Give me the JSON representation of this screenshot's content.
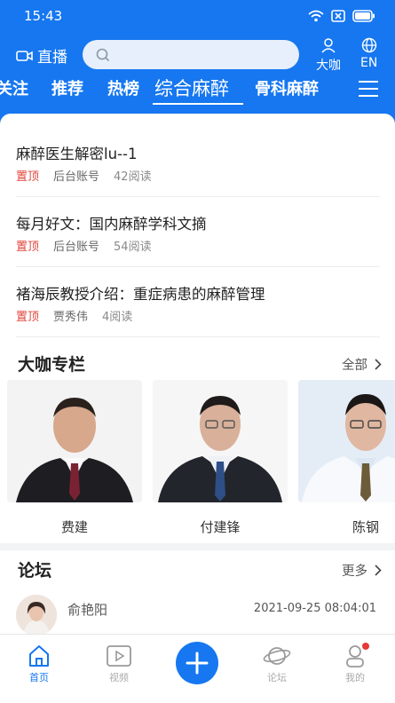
{
  "status_bar": {
    "time": "15:43"
  },
  "header": {
    "live_label": "直播",
    "search_placeholder": "",
    "expert_label": "大咖",
    "lang_label": "EN"
  },
  "tabs": [
    {
      "label": "关注",
      "active": false
    },
    {
      "label": "推荐",
      "active": false
    },
    {
      "label": "热榜",
      "active": false
    },
    {
      "label": "综合麻醉",
      "active": true
    },
    {
      "label": "骨科麻醉",
      "active": false
    }
  ],
  "news": [
    {
      "title": "麻醉医生解密lu--1",
      "tag": "置顶",
      "author": "后台账号",
      "reads": "42阅读"
    },
    {
      "title": "每月好文：国内麻醉学科文摘",
      "tag": "置顶",
      "author": "后台账号",
      "reads": "54阅读"
    },
    {
      "title": "褚海辰教授介绍：重症病患的麻醉管理",
      "tag": "置顶",
      "author": "贾秀伟",
      "reads": "4阅读"
    }
  ],
  "experts_section": {
    "title": "大咖专栏",
    "more": "全部",
    "experts": [
      {
        "name": "费建"
      },
      {
        "name": "付建锋"
      },
      {
        "name": "陈钢"
      }
    ]
  },
  "forum_section": {
    "title": "论坛",
    "more": "更多",
    "post": {
      "user": "俞艳阳",
      "time": "2021-09-25 08:04:01"
    }
  },
  "bottom_nav": {
    "home": "首页",
    "video": "视频",
    "forum": "论坛",
    "mine": "我的"
  },
  "colors": {
    "brand": "#1677f0",
    "top_tag": "#e0443b"
  }
}
